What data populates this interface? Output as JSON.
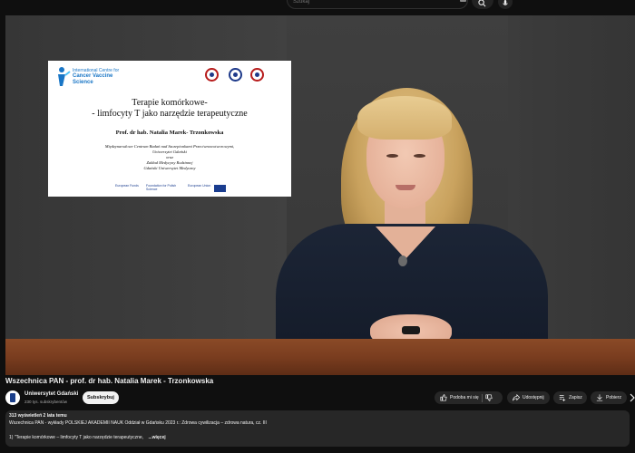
{
  "search": {
    "placeholder": "Szukaj"
  },
  "video": {
    "slide": {
      "logo_line1": "International Centre for",
      "logo_line2": "Cancer Vaccine",
      "logo_line3": "Science",
      "title_line1": "Terapie komórkowe-",
      "title_line2": "- limfocyty T jako narzędzie terapeutyczne",
      "author": "Prof. dr hab. Natalia Marek- Trzonkowska",
      "aff_line1": "Międzynarodowe Centrum Badań nad Szczepionkami Przeciwnowotworowymi,",
      "aff_line2": "Uniwersytet Gdański",
      "aff_line3": "oraz",
      "aff_line4": "Zakład Medycyny Rodzinnej",
      "aff_line5": "Gdański Uniwersytet Medyczny",
      "fund1": "European Funds",
      "fund2": "Foundation for Polish Science",
      "fund3": "European Union"
    }
  },
  "meta": {
    "title": "Wszechnica PAN - prof. dr hab. Natalia Marek - Trzonkowska",
    "channel": "Uniwersytet Gdański",
    "subscribers": "230 tys. subskrybentów",
    "subscribe_label": "Subskrybuj"
  },
  "actions": {
    "like_label": "Podoba mi się",
    "share_label": "Udostępnij",
    "save_label": "Zapisz",
    "download_label": "Pobierz"
  },
  "description": {
    "meta": "313 wyświetleń  2 lata temu",
    "line1": "Wszechnica PAN - wykłady POLSKIEJ AKADEMII NAUK Oddział w Gdańsku 2023 r.: Zdrowa cywilizacja – zdrowa natura, cz. III",
    "line2": "1) \"Terapie komórkowe – limfocyty T jako narzędzie terapeutyczne,",
    "more_label": "...więcej"
  }
}
